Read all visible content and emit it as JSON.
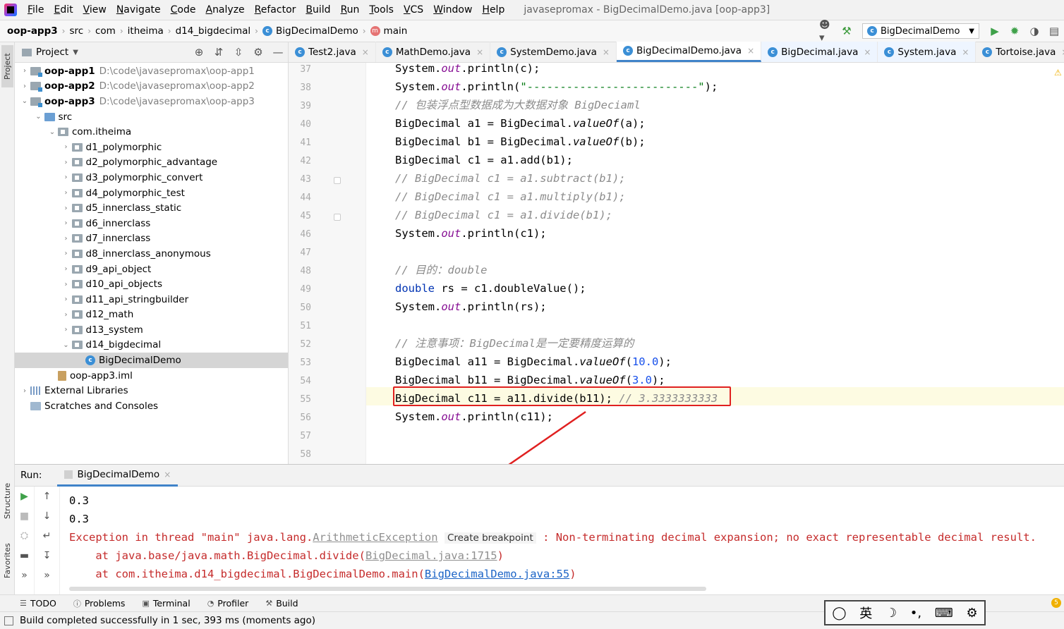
{
  "menubar": {
    "items": [
      "File",
      "Edit",
      "View",
      "Navigate",
      "Code",
      "Analyze",
      "Refactor",
      "Build",
      "Run",
      "Tools",
      "VCS",
      "Window",
      "Help"
    ],
    "title": "javasepromax - BigDecimalDemo.java [oop-app3]"
  },
  "breadcrumb": [
    "oop-app3",
    "src",
    "com",
    "itheima",
    "d14_bigdecimal",
    "BigDecimalDemo",
    "main"
  ],
  "run_config": "BigDecimalDemo",
  "left_strip": {
    "project": "Project",
    "structure": "Structure",
    "favorites": "Favorites"
  },
  "project": {
    "header": "Project",
    "tree": [
      {
        "label": "oop-app1",
        "path": "D:\\code\\javasepromax\\oop-app1",
        "level": 0,
        "arrow": "›",
        "icon": "module",
        "bold": true
      },
      {
        "label": "oop-app2",
        "path": "D:\\code\\javasepromax\\oop-app2",
        "level": 0,
        "arrow": "›",
        "icon": "module",
        "bold": true
      },
      {
        "label": "oop-app3",
        "path": "D:\\code\\javasepromax\\oop-app3",
        "level": 0,
        "arrow": "⌄",
        "icon": "module",
        "bold": true
      },
      {
        "label": "src",
        "level": 1,
        "arrow": "⌄",
        "icon": "src"
      },
      {
        "label": "com.itheima",
        "level": 2,
        "arrow": "⌄",
        "icon": "pkg"
      },
      {
        "label": "d1_polymorphic",
        "level": 3,
        "arrow": "›",
        "icon": "pkg"
      },
      {
        "label": "d2_polymorphic_advantage",
        "level": 3,
        "arrow": "›",
        "icon": "pkg"
      },
      {
        "label": "d3_polymorphic_convert",
        "level": 3,
        "arrow": "›",
        "icon": "pkg"
      },
      {
        "label": "d4_polymorphic_test",
        "level": 3,
        "arrow": "›",
        "icon": "pkg"
      },
      {
        "label": "d5_innerclass_static",
        "level": 3,
        "arrow": "›",
        "icon": "pkg"
      },
      {
        "label": "d6_innerclass",
        "level": 3,
        "arrow": "›",
        "icon": "pkg"
      },
      {
        "label": "d7_innerclass",
        "level": 3,
        "arrow": "›",
        "icon": "pkg"
      },
      {
        "label": "d8_innerclass_anonymous",
        "level": 3,
        "arrow": "›",
        "icon": "pkg"
      },
      {
        "label": "d9_api_object",
        "level": 3,
        "arrow": "›",
        "icon": "pkg"
      },
      {
        "label": "d10_api_objects",
        "level": 3,
        "arrow": "›",
        "icon": "pkg"
      },
      {
        "label": "d11_api_stringbuilder",
        "level": 3,
        "arrow": "›",
        "icon": "pkg"
      },
      {
        "label": "d12_math",
        "level": 3,
        "arrow": "›",
        "icon": "pkg"
      },
      {
        "label": "d13_system",
        "level": 3,
        "arrow": "›",
        "icon": "pkg"
      },
      {
        "label": "d14_bigdecimal",
        "level": 3,
        "arrow": "⌄",
        "icon": "pkg"
      },
      {
        "label": "BigDecimalDemo",
        "level": 4,
        "arrow": "",
        "icon": "class",
        "selected": true
      },
      {
        "label": "oop-app3.iml",
        "level": 2,
        "arrow": "",
        "icon": "iml"
      },
      {
        "label": "External Libraries",
        "level": 0,
        "arrow": "›",
        "icon": "lib"
      },
      {
        "label": "Scratches and Consoles",
        "level": 0,
        "arrow": "",
        "icon": "scratch"
      }
    ]
  },
  "editor_tabs": [
    {
      "label": "Test2.java",
      "active": false
    },
    {
      "label": "MathDemo.java",
      "active": false
    },
    {
      "label": "SystemDemo.java",
      "active": false
    },
    {
      "label": "BigDecimalDemo.java",
      "active": true
    },
    {
      "label": "BigDecimal.java",
      "active": false,
      "lib": true
    },
    {
      "label": "System.java",
      "active": false,
      "lib": true
    },
    {
      "label": "Tortoise.java",
      "active": false
    }
  ],
  "line_numbers": [
    "37",
    "38",
    "39",
    "40",
    "41",
    "42",
    "43",
    "44",
    "45",
    "46",
    "47",
    "48",
    "49",
    "50",
    "51",
    "52",
    "53",
    "54",
    "55",
    "56",
    "57",
    "58"
  ],
  "code_lines": [
    [
      [
        "System.",
        ""
      ],
      [
        "out",
        "st"
      ],
      [
        ".println(c);",
        ""
      ]
    ],
    [
      [
        "System.",
        ""
      ],
      [
        "out",
        "st"
      ],
      [
        ".println(",
        ""
      ],
      [
        "\"--------------------------\"",
        "s"
      ],
      [
        ");",
        ""
      ]
    ],
    [
      [
        "// 包装浮点型数据成为大数据对象 BigDeciaml",
        "c"
      ]
    ],
    [
      [
        "BigDecimal a1 = BigDecimal.",
        ""
      ],
      [
        "valueOf",
        "fn"
      ],
      [
        "(a);",
        ""
      ]
    ],
    [
      [
        "BigDecimal b1 = BigDecimal.",
        ""
      ],
      [
        "valueOf",
        "fn"
      ],
      [
        "(b);",
        ""
      ]
    ],
    [
      [
        "BigDecimal c1 = a1.add(b1);",
        ""
      ]
    ],
    [
      [
        "// BigDecimal c1 = a1.subtract(b1);",
        "c"
      ]
    ],
    [
      [
        "// BigDecimal c1 = a1.multiply(b1);",
        "c"
      ]
    ],
    [
      [
        "// BigDecimal c1 = a1.divide(b1);",
        "c"
      ]
    ],
    [
      [
        "System.",
        ""
      ],
      [
        "out",
        "st"
      ],
      [
        ".println(c1);",
        ""
      ]
    ],
    [],
    [
      [
        "// 目的：double",
        "c"
      ]
    ],
    [
      [
        "double",
        "k"
      ],
      [
        " rs = c1.doubleValue();",
        ""
      ]
    ],
    [
      [
        "System.",
        ""
      ],
      [
        "out",
        "st"
      ],
      [
        ".println(rs);",
        ""
      ]
    ],
    [],
    [
      [
        "// 注意事项：BigDecimal是一定要精度运算的",
        "c"
      ]
    ],
    [
      [
        "BigDecimal a11 = BigDecimal.",
        ""
      ],
      [
        "valueOf",
        "fn"
      ],
      [
        "(",
        ""
      ],
      [
        "10.0",
        "n"
      ],
      [
        ");",
        ""
      ]
    ],
    [
      [
        "BigDecimal b11 = BigDecimal.",
        ""
      ],
      [
        "valueOf",
        "fn"
      ],
      [
        "(",
        ""
      ],
      [
        "3.0",
        "n"
      ],
      [
        ");",
        ""
      ]
    ],
    [
      [
        "BigDecimal c11 = a11.divide(b11); ",
        ""
      ],
      [
        "// 3.3333333333",
        "c"
      ]
    ],
    [
      [
        "System.",
        ""
      ],
      [
        "out",
        "st"
      ],
      [
        ".println(c11);",
        ""
      ]
    ],
    [],
    []
  ],
  "run": {
    "label": "Run:",
    "tab": "BigDecimalDemo",
    "out1": "0.3",
    "out2": "0.3",
    "exc_prefix": "Exception in thread \"main\" java.lang.",
    "exc_class": "ArithmeticException",
    "exc_tooltip": "Create breakpoint",
    "exc_msg": " : Non-terminating decimal expansion; no exact representable decimal result.",
    "trace1_prefix": "    at java.base/java.math.BigDecimal.divide(",
    "trace1_link": "BigDecimal.java:1715",
    "trace1_suffix": ")",
    "trace2_prefix": "    at com.itheima.d14_bigdecimal.BigDecimalDemo.main(",
    "trace2_link": "BigDecimalDemo.java:55",
    "trace2_suffix": ")"
  },
  "bottom_tabs": [
    "TODO",
    "Problems",
    "Terminal",
    "Profiler",
    "Build"
  ],
  "status_text": "Build completed successfully in 1 sec, 393 ms (moments ago)",
  "ime": {
    "lang": "英"
  },
  "colors": {
    "accent": "#4083c9",
    "annotation_red": "#e02020",
    "error_text": "#c52b2b",
    "keyword": "#0033b3",
    "string": "#067d17",
    "comment": "#8c8c8c",
    "number": "#1750eb",
    "static_field": "#871094"
  }
}
